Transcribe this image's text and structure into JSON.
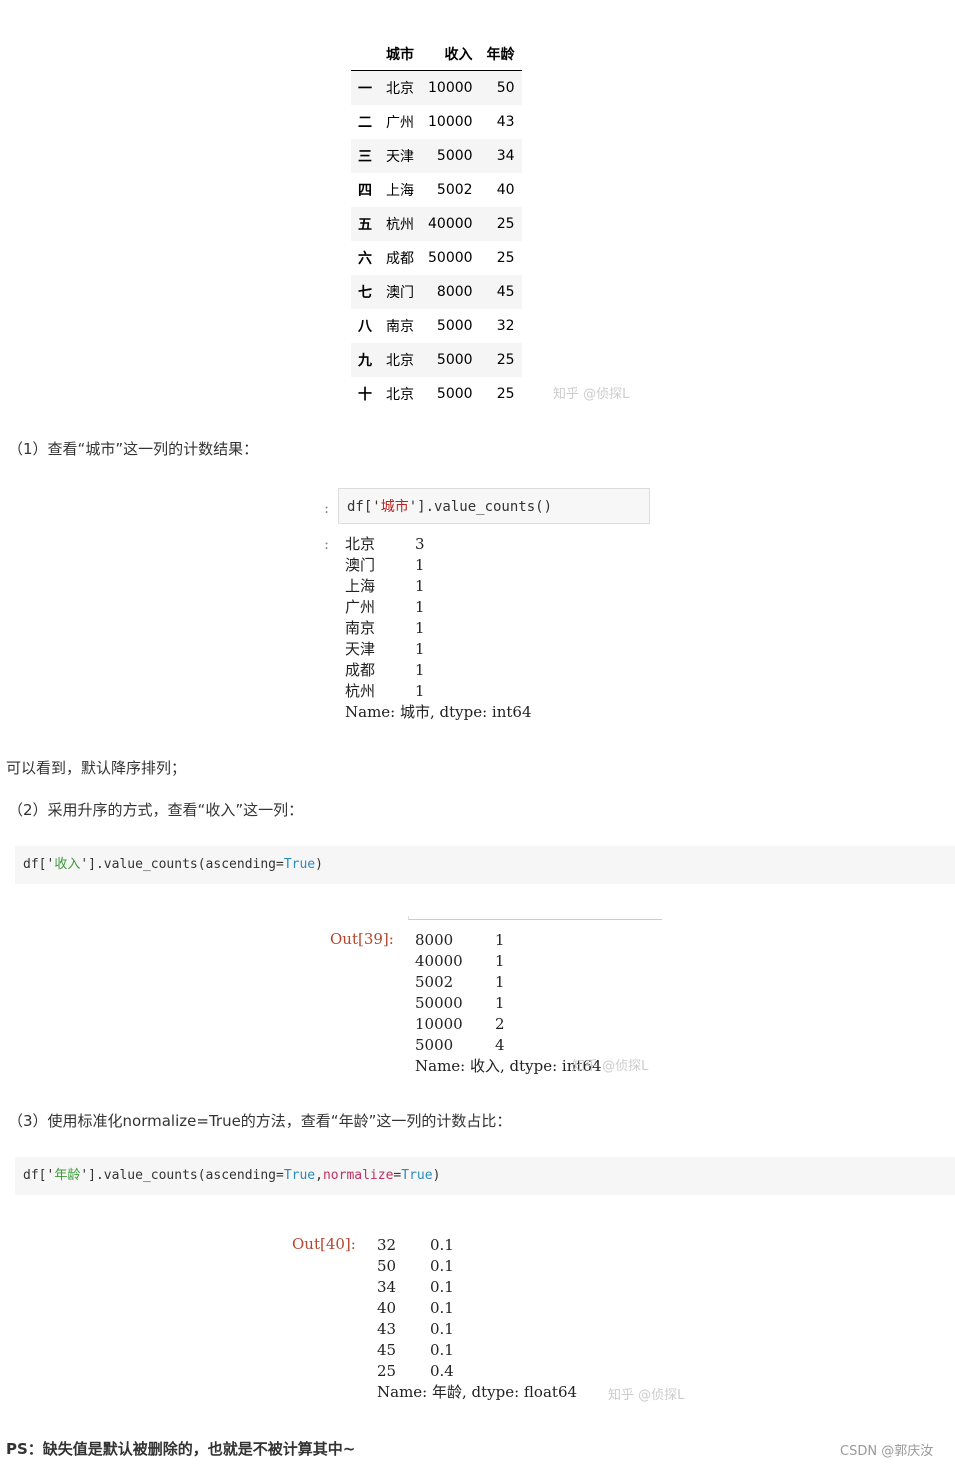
{
  "table": {
    "headers": [
      "",
      "城市",
      "收入",
      "年龄"
    ],
    "rows": [
      [
        "一",
        "北京",
        "10000",
        "50"
      ],
      [
        "二",
        "广州",
        "10000",
        "43"
      ],
      [
        "三",
        "天津",
        "5000",
        "34"
      ],
      [
        "四",
        "上海",
        "5002",
        "40"
      ],
      [
        "五",
        "杭州",
        "40000",
        "25"
      ],
      [
        "六",
        "成都",
        "50000",
        "25"
      ],
      [
        "七",
        "澳门",
        "8000",
        "45"
      ],
      [
        "八",
        "南京",
        "5000",
        "32"
      ],
      [
        "九",
        "北京",
        "5000",
        "25"
      ],
      [
        "十",
        "北京",
        "5000",
        "25"
      ]
    ]
  },
  "watermark": "知乎 @侦探L",
  "step1": "（1）查看“城市”这一列的计数结果：",
  "cell1": {
    "prompt": ":",
    "code_a": "df['",
    "code_str": "城市",
    "code_b": "'].value_counts()",
    "out_prompt": ":",
    "rows": [
      [
        "北京",
        "3"
      ],
      [
        "澳门",
        "1"
      ],
      [
        "上海",
        "1"
      ],
      [
        "广州",
        "1"
      ],
      [
        "南京",
        "1"
      ],
      [
        "天津",
        "1"
      ],
      [
        "成都",
        "1"
      ],
      [
        "杭州",
        "1"
      ]
    ],
    "footer": "Name: 城市, dtype: int64"
  },
  "note1": "可以看到，默认降序排列；",
  "step2": "（2）采用升序的方式，查看“收入”这一列：",
  "code2": {
    "a": "df['",
    "str": "收入",
    "b": "'].value_counts(ascending=",
    "kw": "True",
    "c": ")"
  },
  "out2": {
    "label": "Out[39]:",
    "rows": [
      [
        "8000",
        "1"
      ],
      [
        "40000",
        "1"
      ],
      [
        "5002",
        "1"
      ],
      [
        "50000",
        "1"
      ],
      [
        "10000",
        "2"
      ],
      [
        "5000",
        "4"
      ]
    ],
    "footer": "Name: 收入, dtype: int64"
  },
  "step3": "（3）使用标准化normalize=True的方法，查看“年龄”这一列的计数占比：",
  "code3": {
    "a": "df['",
    "str": "年龄",
    "b": "'].value_counts(ascending=",
    "kw": "True",
    ",": ",",
    "param": "normalize",
    "eq": "=",
    "kw2": "True",
    "c": ")"
  },
  "out3": {
    "label": "Out[40]:",
    "rows": [
      [
        "32",
        "0.1"
      ],
      [
        "50",
        "0.1"
      ],
      [
        "34",
        "0.1"
      ],
      [
        "40",
        "0.1"
      ],
      [
        "43",
        "0.1"
      ],
      [
        "45",
        "0.1"
      ],
      [
        "25",
        "0.4"
      ]
    ],
    "footer": "Name: 年龄, dtype: float64"
  },
  "ps": "PS：缺失值是默认被删除的，也就是不被计算其中~",
  "credit": "CSDN @郭庆汝"
}
